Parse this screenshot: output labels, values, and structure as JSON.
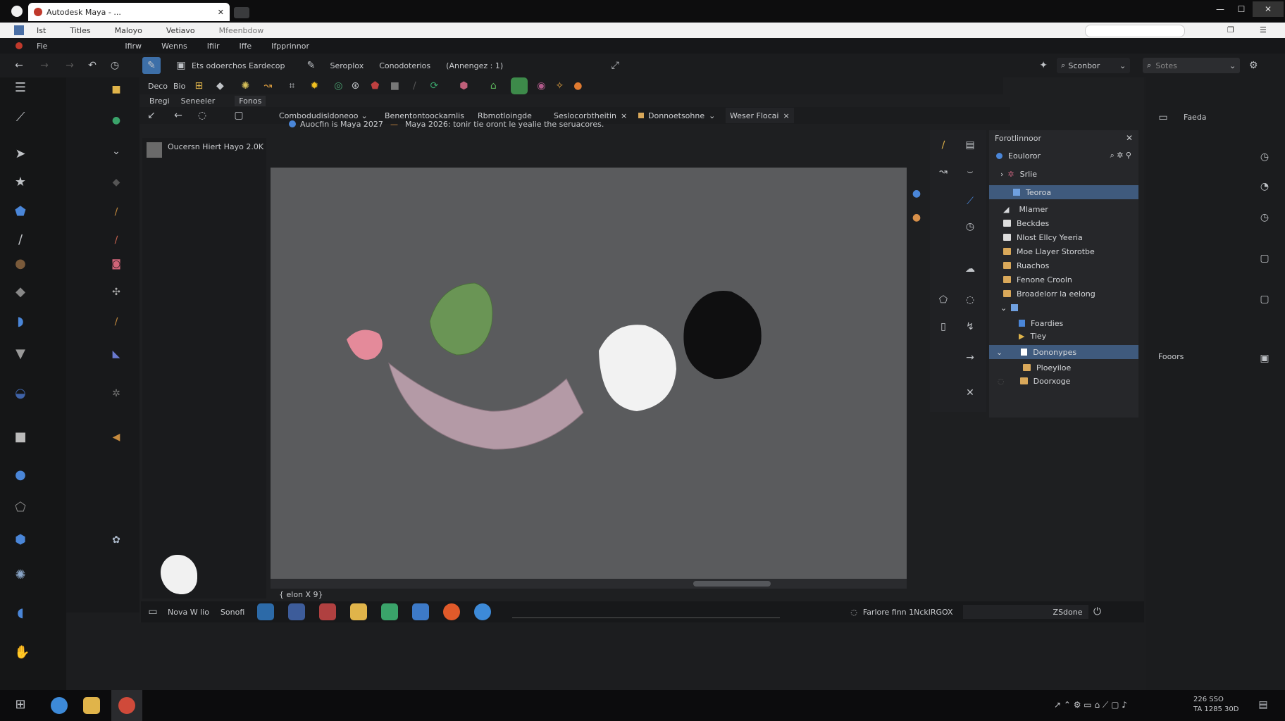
{
  "browser": {
    "tab_title": "Autodesk Maya - ...",
    "menu": [
      "Ist",
      "Titles",
      "Maloyo",
      "Vetiavo",
      "Mfeenbdow"
    ]
  },
  "app": {
    "menus": [
      "Fie",
      "Ifirw",
      "Wenns",
      "Ifiir",
      "Iffe",
      "Ifpprinnor"
    ],
    "toolbar_title": "Ets odoerchos Eardecop",
    "toolbar_items": [
      "Seroplox",
      "Conodoterios",
      "(Annengez : 1)"
    ],
    "search_left": "Sconbor",
    "search_right": "Sotes",
    "shelf_labels": [
      "Deco",
      "Bio"
    ],
    "second_row_labels": [
      "Bregi",
      "Seneeler",
      "Fonos"
    ],
    "doc_tabs": [
      {
        "label": "Combodudisldoneoo"
      },
      {
        "label": "Benentontoockarnlis"
      },
      {
        "label": "Rbmotloingde"
      },
      {
        "label": "Seslocorbtheitin"
      },
      {
        "label": "Donnoetsohne"
      },
      {
        "label": "Weser Flocai"
      }
    ],
    "outliner_item": "Oucersn Hiert Hayo 2.0K",
    "notice": {
      "badge": "Auocfin is Maya 2027",
      "text": "Maya 2026: tonir tie oront le yealie the seruacores."
    },
    "viewport_footer": "{ elon X 9}",
    "status_left": "Nova W lio",
    "status_mid": "Sonofi",
    "status_right": "Farlore finn 1NcklRGOX",
    "status_button": "ZSdone"
  },
  "outliner": {
    "title": "Forotlinnoor",
    "items": [
      {
        "label": "Eouloror",
        "level": 0
      },
      {
        "label": "Srlie",
        "level": 1
      },
      {
        "label": "Teoroa",
        "level": 1,
        "selected": true
      },
      {
        "label": "Mlamer",
        "level": 1
      },
      {
        "label": "Beckdes",
        "level": 1
      },
      {
        "label": "Nlost Ellcy Yeeria",
        "level": 1
      },
      {
        "label": "Moe Llayer Storotbe",
        "level": 1
      },
      {
        "label": "Ruachos",
        "level": 1
      },
      {
        "label": "Fenone Crooln",
        "level": 1
      },
      {
        "label": "Broadelorr la eelong",
        "level": 1
      },
      {
        "label": "",
        "level": 1
      },
      {
        "label": "Foardies",
        "level": 2
      },
      {
        "label": "Tiey",
        "level": 2
      },
      {
        "label": "Dononypes",
        "level": 2,
        "selected": true
      },
      {
        "label": "Ploeyiloe",
        "level": 2
      },
      {
        "label": "Doorxoge",
        "level": 2
      }
    ]
  },
  "far_right": {
    "top_label": "Faeda",
    "mid_label": "Fooors"
  },
  "taskbar": {
    "clock": "226 SSO",
    "date": "TA 1285 30D"
  },
  "colors": {
    "viewport": "#5a5b5d",
    "selection": "#3f5a7d",
    "folder": "#d9a85a"
  }
}
